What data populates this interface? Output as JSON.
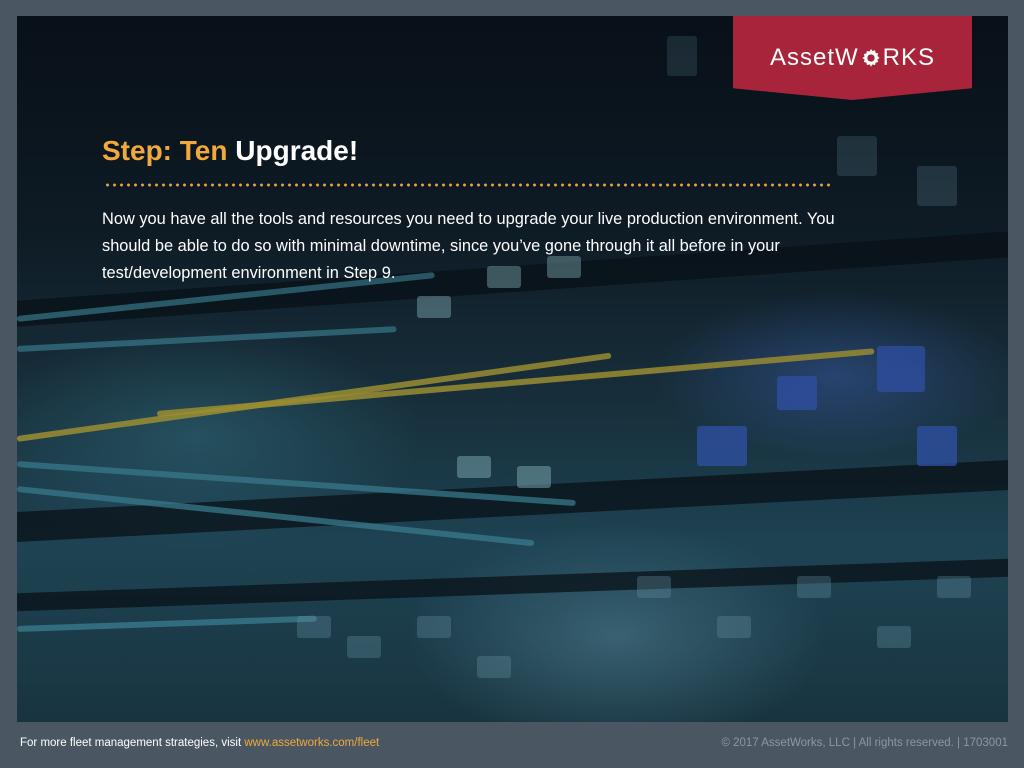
{
  "logo": {
    "text_before": "AssetW",
    "text_after": "RKS",
    "icon": "gear-icon",
    "badge_color": "#a8243a"
  },
  "title": {
    "accent": "Step: Ten",
    "rest": "Upgrade!"
  },
  "body": "Now you have all the tools and resources you need to upgrade your live production environment. You should be able to do so with minimal downtime, since you’ve gone through it all before in your test/development environment in Step 9.",
  "footer": {
    "prefix": "For more fleet management strategies, visit ",
    "link": "www.assetworks.com/fleet",
    "copyright": "© 2017 AssetWorks, LLC | All rights reserved. | 1703001"
  },
  "colors": {
    "accent": "#f2a93b",
    "background": "#4a5763"
  }
}
